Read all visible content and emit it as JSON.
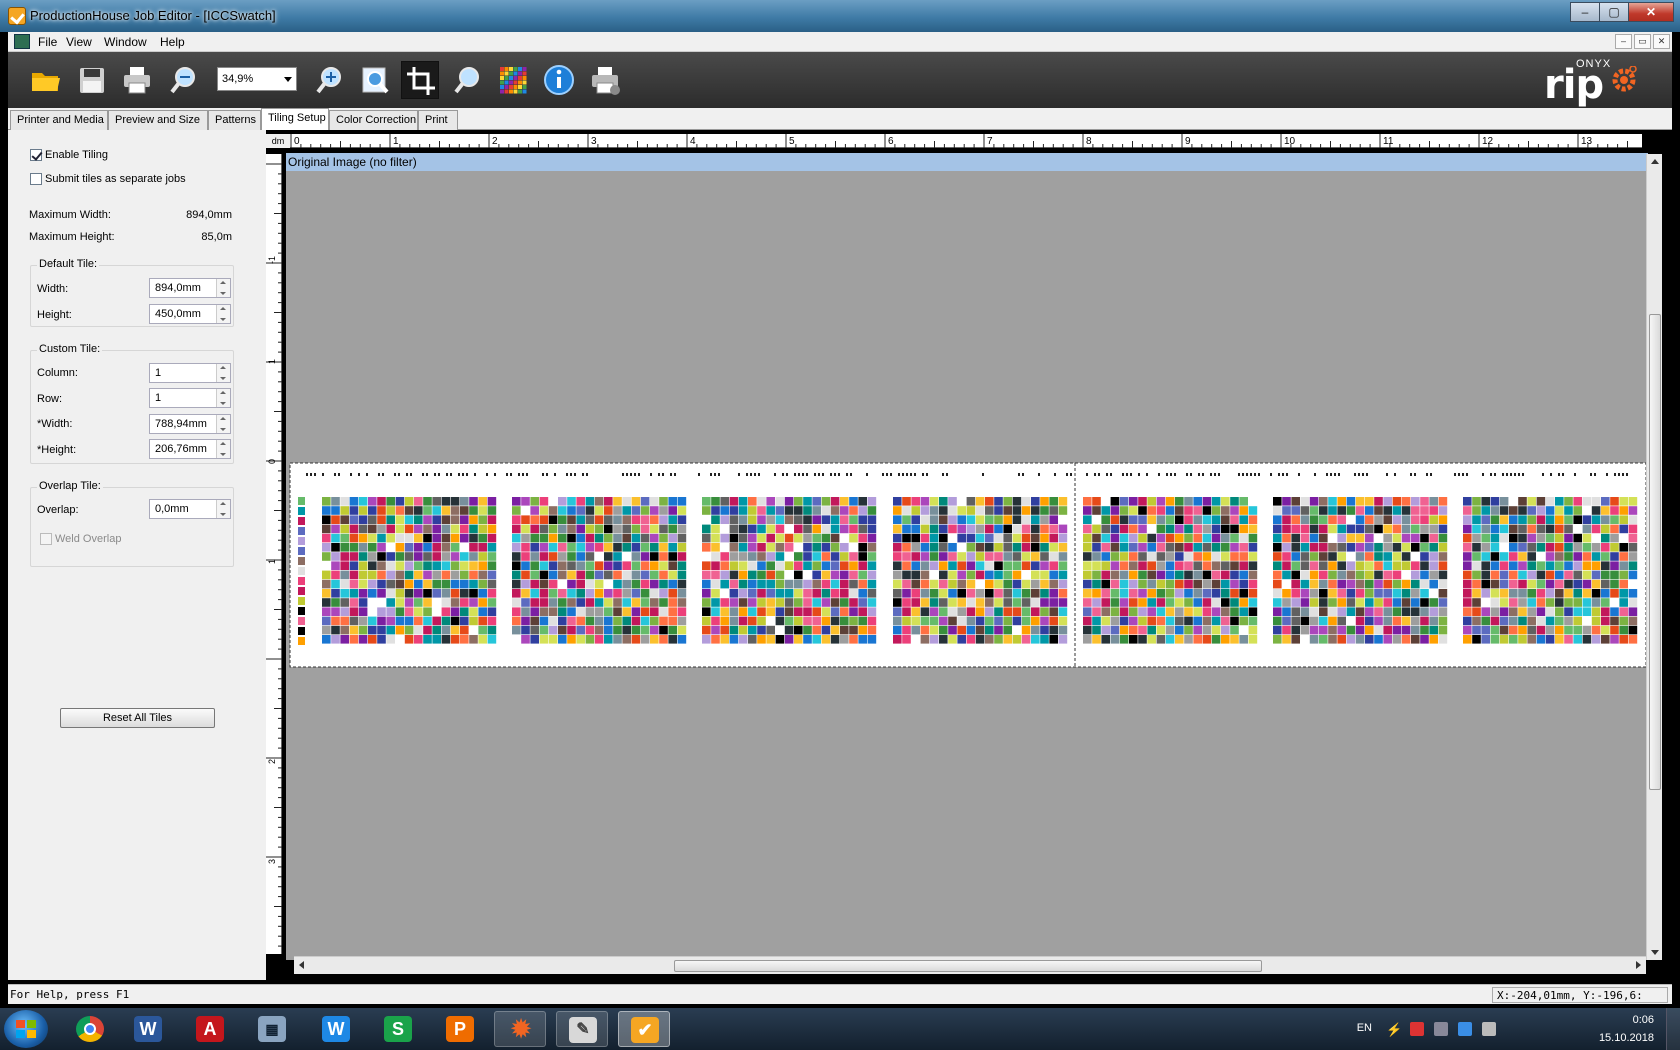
{
  "window": {
    "title": "ProductionHouse Job Editor - [ICCSwatch]",
    "min_label": "–",
    "max_label": "▢",
    "close_label": "✕"
  },
  "menu": {
    "items": [
      "File",
      "View",
      "Window",
      "Help"
    ],
    "mdi_controls": [
      "–",
      "▭",
      "✕"
    ]
  },
  "toolbar": {
    "icons": [
      "open-folder-icon",
      "save-icon",
      "print-icon",
      "zoom-out-icon",
      "zoom-in-icon",
      "zoom-fit-icon",
      "crop-icon",
      "magnify-icon",
      "grid-icon",
      "info-icon",
      "printer-send-icon"
    ],
    "zoom_value": "34,9%"
  },
  "logo": {
    "brand_small": "ONYX",
    "brand_large": "rip",
    "accent": "#f26522"
  },
  "tabs": [
    "Printer and Media",
    "Preview and Size",
    "Patterns",
    "Tiling Setup",
    "Color Correction",
    "Print"
  ],
  "active_tab": "Tiling Setup",
  "tiling": {
    "enable_tiling": "Enable Tiling",
    "submit_separate": "Submit tiles as separate jobs",
    "max_width_label": "Maximum Width:",
    "max_width_value": "894,0mm",
    "max_height_label": "Maximum Height:",
    "max_height_value": "85,0m",
    "default_tile": {
      "label": "Default Tile:",
      "width_label": "Width:",
      "width_value": "894,0mm",
      "height_label": "Height:",
      "height_value": "450,0mm"
    },
    "custom_tile": {
      "label": "Custom Tile:",
      "column_label": "Column:",
      "column_value": "1",
      "row_label": "Row:",
      "row_value": "1",
      "width_label": "*Width:",
      "width_value": "788,94mm",
      "height_label": "*Height:",
      "height_value": "206,76mm"
    },
    "overlap_tile": {
      "label": "Overlap Tile:",
      "overlap_label": "Overlap:",
      "overlap_value": "0,0mm",
      "weld_label": "Weld Overlap"
    },
    "reset_button": "Reset All Tiles"
  },
  "ruler": {
    "unit": "dm",
    "h_labels": [
      "0",
      "1",
      "2",
      "3",
      "4",
      "5",
      "6",
      "7",
      "8",
      "9",
      "10",
      "11",
      "12",
      "13"
    ],
    "v_labels": [
      "-1",
      "1",
      "0",
      "1",
      "2",
      "3",
      "4"
    ]
  },
  "preview": {
    "header": "Original Image (no filter)"
  },
  "status": {
    "help": "For Help, press F1",
    "coords": "X:-204,01mm, Y:-196,6:"
  },
  "taskbar": {
    "apps": [
      "chrome-icon",
      "word-icon",
      "acrobat-icon",
      "calculator-icon",
      "writer-icon",
      "sheets-icon",
      "presentation-icon",
      "onyx-gear-icon",
      "onyx-tool-icon",
      "onyx-job-icon"
    ],
    "lang": "EN",
    "time": "0:06",
    "date": "15.10.2018"
  }
}
